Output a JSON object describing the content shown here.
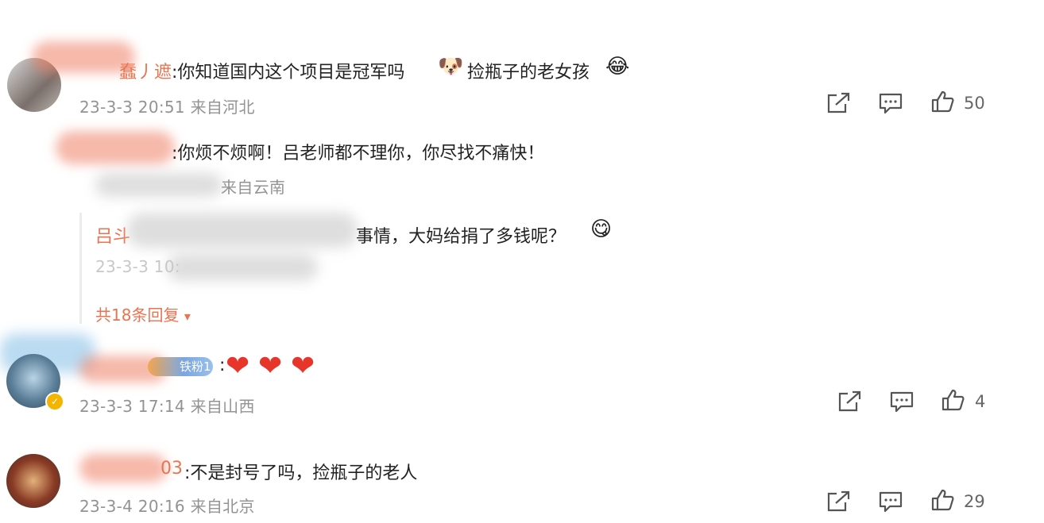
{
  "comments": [
    {
      "name_tail": "蠢丿遮",
      "text": ":你知道国内这个项目是冠军吗",
      "text2": "捡瓶子的老女孩",
      "emoji1": "🐶",
      "emoji2": "😂",
      "meta": "23-3-3 20:51 来自河北",
      "likes": "50"
    },
    {
      "reply_text": ":你烦不烦啊！吕老师都不理你，你尽找不痛快！",
      "reply_meta": "来自云南",
      "quote_name": "吕斗",
      "quote_text": "事情，大妈给捐了多钱呢？",
      "quote_emoji": "😋",
      "quote_meta": "23-3-3 10:",
      "more_replies": "共18条回复",
      "more_arrow": "▾"
    },
    {
      "badge": "铁粉1",
      "text": ":",
      "hearts": [
        "❤",
        "❤",
        "❤"
      ],
      "meta": "23-3-3 17:14 来自山西",
      "likes": "4"
    },
    {
      "name_tail": "03",
      "text": ":不是封号了吗，捡瓶子的老人",
      "meta": "23-3-4 20:16 来自北京",
      "likes": "29"
    }
  ],
  "colors": {
    "name": "#eb7350",
    "meta": "#939393",
    "heart": "#e8352a",
    "icon": "#555555"
  }
}
